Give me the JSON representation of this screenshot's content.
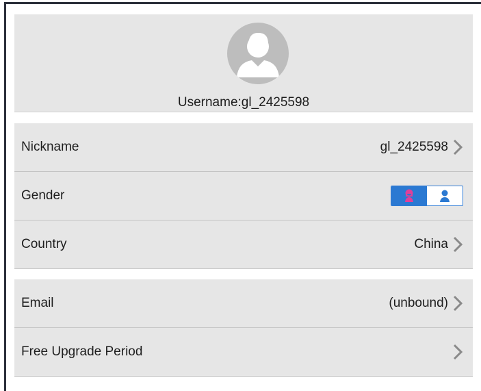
{
  "profile": {
    "username_text": "Username:gl_2425598",
    "avatar_icon": "default-user-avatar-icon"
  },
  "rows": {
    "nickname": {
      "label": "Nickname",
      "value": "gl_2425598"
    },
    "gender": {
      "label": "Gender",
      "options": [
        {
          "name": "female-icon",
          "selected": true,
          "color": "#e0409a"
        },
        {
          "name": "male-icon",
          "selected": false,
          "color": "#2b79d2"
        }
      ]
    },
    "country": {
      "label": "Country",
      "value": "China"
    },
    "email": {
      "label": "Email",
      "value": "(unbound)"
    },
    "upgrade": {
      "label": "Free Upgrade Period",
      "value": ""
    }
  },
  "colors": {
    "card_bg": "#e6e6e6",
    "accent_blue": "#2b79d2",
    "female_pink": "#e0409a",
    "chevron": "#8a8a8a"
  }
}
